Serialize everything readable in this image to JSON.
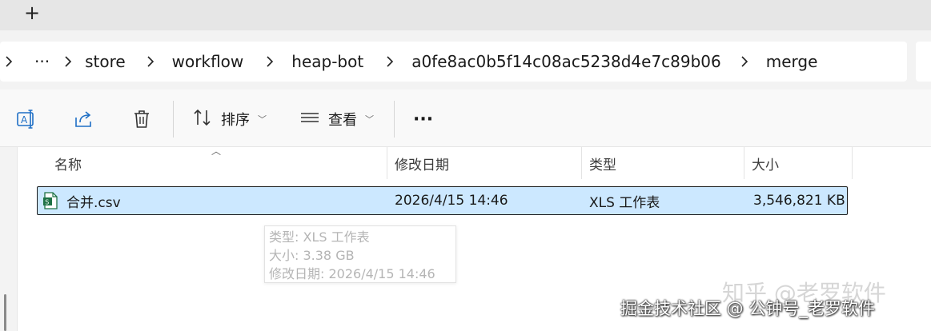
{
  "tab_strip": {
    "new_tab_label": "+"
  },
  "breadcrumb": {
    "items": [
      "···",
      "store",
      "workflow",
      "heap-bot",
      "a0fe8ac0b5f14c08ac5238d4e7c89b06",
      "merge"
    ]
  },
  "toolbar": {
    "sort_label": "排序",
    "view_label": "查看",
    "more_label": "···"
  },
  "columns": {
    "name": "名称",
    "modified": "修改日期",
    "type": "类型",
    "size": "大小"
  },
  "files": [
    {
      "name": "合并.csv",
      "modified": "2026/4/15 14:46",
      "type": "XLS 工作表",
      "size": "3,546,821 KB"
    }
  ],
  "tooltip": {
    "type_line": "类型: XLS 工作表",
    "size_line": "大小: 3.38 GB",
    "modified_line": "修改日期: 2026/4/15 14:46"
  },
  "watermarks": {
    "top": "知乎 @老罗软件",
    "bottom": "掘金技术社区 @ 公钟号_老罗软件"
  },
  "colors": {
    "selection": "#cce8ff",
    "icon_blue": "#1f6fc5",
    "csv_icon": "#1e7145"
  }
}
